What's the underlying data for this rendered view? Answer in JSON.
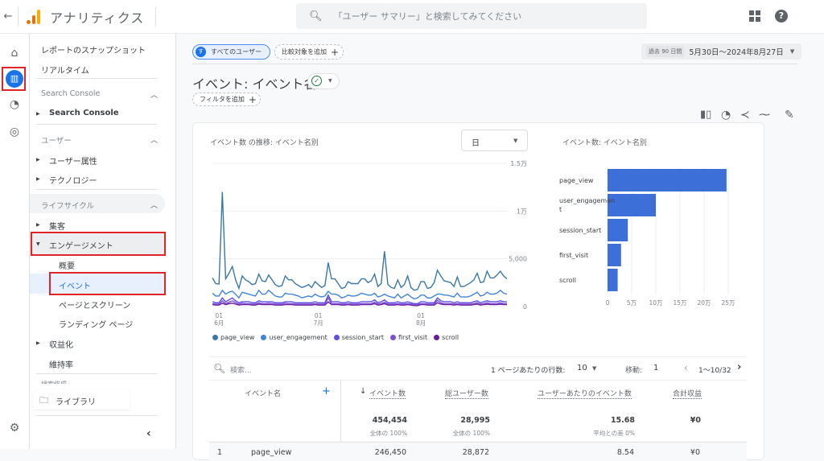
{
  "app": {
    "title": "アナリティクス",
    "back_icon": "arrow-left-icon",
    "logo_colors": [
      "#f9ab00",
      "#e37400",
      "#e37400"
    ]
  },
  "search": {
    "placeholder": "「ユーザー サマリー」と検索してみてください"
  },
  "header_icons": [
    "apps-grid-icon",
    "help-icon"
  ],
  "rail": [
    {
      "name": "home-icon",
      "glyph": "⌂"
    },
    {
      "name": "reports-icon",
      "glyph": "▥",
      "active": true
    },
    {
      "name": "explore-icon",
      "glyph": "◔"
    },
    {
      "name": "advertising-icon",
      "glyph": "◎"
    },
    {
      "name": "settings-icon",
      "glyph": "⚙"
    }
  ],
  "nav": {
    "top_items": [
      "レポートのスナップショット",
      "リアルタイム"
    ],
    "sections": [
      {
        "header": "Search Console",
        "items": [
          {
            "label": "Search Console",
            "bold": true
          }
        ]
      },
      {
        "header": "ユーザー",
        "items": [
          {
            "label": "ユーザー属性"
          },
          {
            "label": "テクノロジー"
          }
        ]
      },
      {
        "header": "ライフサイクル",
        "items": [
          {
            "label": "集客"
          },
          {
            "label": "エンゲージメント",
            "expanded": true
          }
        ]
      }
    ],
    "engagement_sub": [
      "概要",
      "イベント",
      "ページとスクリーン",
      "ランディング ページ"
    ],
    "after_items": [
      "収益化",
      "維持率"
    ],
    "partial_header": "検索作成",
    "library": "ライブラリ",
    "collapse_icon": "‹"
  },
  "main": {
    "segment_label": "すべてのユーザー",
    "segment_badge": "す",
    "compare_label": "比較対象を追加",
    "date_prefix": "過去 90 日間",
    "date_range": "5月30日～2024年8月27日",
    "page_title": "イベント: イベント名",
    "filter_label": "フィルタを追加",
    "toolbar_icons": [
      "compare-icon",
      "insights-icon",
      "share-icon",
      "trend-icon",
      "edit-icon"
    ]
  },
  "chart_data": [
    {
      "type": "line",
      "title": "イベント数 の推移: イベント名別",
      "granularity": "日",
      "y_ticks": [
        "0",
        "5,000",
        "1万",
        "1.5万"
      ],
      "ylim": [
        0,
        15000
      ],
      "x_ticks": [
        {
          "day": "01",
          "month": "6月"
        },
        {
          "day": "01",
          "month": "7月"
        },
        {
          "day": "01",
          "month": "8月"
        }
      ],
      "series": [
        {
          "name": "page_view",
          "color": "#3b78a6",
          "values": [
            3000,
            2400,
            2350,
            12000,
            2900,
            3500,
            4200,
            2800,
            1900,
            3200,
            2800,
            2600,
            2300,
            2400,
            3400,
            2700,
            2600,
            3300,
            2800,
            2300,
            2100,
            2200,
            3200,
            2800,
            2800,
            2400,
            2200,
            2000,
            2100,
            2300,
            2000,
            2600,
            2300,
            2000,
            2200,
            4600,
            2900,
            2900,
            2400,
            1900,
            2000,
            2600,
            2400,
            2400,
            2400,
            2900,
            2900,
            2500,
            2700,
            3400,
            2100,
            2400,
            5800,
            2300,
            2000,
            1900,
            2800,
            2000,
            2300,
            3200,
            2000,
            1700,
            1800,
            2600,
            2600,
            1900,
            2000,
            2500,
            3800,
            3200,
            2700,
            2600,
            2500,
            2100,
            3100,
            2100,
            2100,
            2300,
            2500,
            2800,
            3500,
            2500,
            2600,
            3700,
            3000,
            3000,
            3300,
            3700,
            3200,
            2900
          ]
        },
        {
          "name": "user_engagement",
          "color": "#4285d6",
          "values": [
            1400,
            1100,
            1100,
            1700,
            1300,
            1500,
            1600,
            1300,
            900,
            1500,
            1400,
            1300,
            1200,
            1100,
            1700,
            1300,
            1300,
            1700,
            1400,
            1100,
            1000,
            1000,
            1400,
            1300,
            1300,
            1200,
            1100,
            900,
            1000,
            1100,
            1000,
            1300,
            1100,
            1000,
            1100,
            1600,
            1300,
            1300,
            1200,
            900,
            1000,
            1200,
            1100,
            1100,
            1200,
            1400,
            1300,
            1200,
            1200,
            1400,
            1000,
            1100,
            1300,
            1100,
            1000,
            900,
            1300,
            900,
            1100,
            1300,
            1000,
            800,
            900,
            1200,
            1200,
            900,
            900,
            1100,
            1300,
            1300,
            1200,
            1200,
            1100,
            1000,
            1400,
            1000,
            1000,
            1000,
            1100,
            1300,
            1500,
            1100,
            1200,
            1500,
            1300,
            1300,
            1400,
            1700,
            1400,
            1300
          ]
        },
        {
          "name": "session_start",
          "color": "#5b4ee8",
          "values": [
            500,
            400,
            400,
            900,
            500,
            700,
            900,
            600,
            400,
            500,
            500,
            500,
            400,
            400,
            600,
            500,
            500,
            500,
            500,
            400,
            400,
            400,
            500,
            500,
            500,
            400,
            400,
            400,
            400,
            400,
            400,
            500,
            400,
            400,
            400,
            1200,
            500,
            500,
            500,
            400,
            400,
            500,
            400,
            400,
            400,
            500,
            500,
            500,
            500,
            700,
            400,
            500,
            700,
            400,
            400,
            400,
            500,
            400,
            400,
            500,
            400,
            300,
            300,
            500,
            500,
            400,
            400,
            400,
            900,
            600,
            500,
            500,
            500,
            400,
            500,
            400,
            400,
            400,
            400,
            500,
            600,
            400,
            500,
            600,
            500,
            500,
            500,
            600,
            500,
            500
          ]
        },
        {
          "name": "first_visit",
          "color": "#7e4fd6",
          "values": [
            300,
            250,
            250,
            600,
            300,
            450,
            600,
            400,
            250,
            350,
            300,
            300,
            250,
            250,
            400,
            300,
            300,
            350,
            300,
            250,
            250,
            250,
            350,
            300,
            300,
            250,
            250,
            250,
            250,
            250,
            250,
            300,
            250,
            250,
            250,
            900,
            300,
            300,
            300,
            250,
            250,
            300,
            250,
            250,
            250,
            300,
            300,
            300,
            300,
            450,
            250,
            300,
            450,
            250,
            250,
            250,
            300,
            250,
            250,
            300,
            250,
            200,
            200,
            300,
            300,
            250,
            250,
            250,
            650,
            400,
            300,
            300,
            300,
            250,
            300,
            250,
            250,
            250,
            250,
            300,
            400,
            250,
            300,
            400,
            300,
            300,
            300,
            400,
            300,
            300
          ]
        },
        {
          "name": "scroll",
          "color": "#6a1b9a",
          "values": [
            200,
            150,
            150,
            350,
            200,
            300,
            350,
            250,
            150,
            200,
            200,
            200,
            150,
            150,
            250,
            200,
            200,
            200,
            200,
            150,
            150,
            150,
            200,
            200,
            200,
            150,
            150,
            150,
            150,
            150,
            150,
            200,
            150,
            150,
            150,
            500,
            200,
            200,
            200,
            150,
            150,
            200,
            150,
            150,
            150,
            200,
            200,
            200,
            200,
            300,
            150,
            200,
            300,
            150,
            150,
            150,
            200,
            150,
            150,
            200,
            150,
            100,
            100,
            200,
            200,
            150,
            150,
            150,
            400,
            250,
            200,
            200,
            200,
            150,
            200,
            150,
            150,
            150,
            150,
            200,
            250,
            150,
            200,
            250,
            200,
            200,
            200,
            250,
            200,
            200
          ]
        }
      ]
    },
    {
      "type": "bar",
      "orientation": "horizontal",
      "title": "イベント数: イベント名別",
      "categories": [
        "page_view",
        "user_engagement",
        "session_start",
        "first_visit",
        "scroll"
      ],
      "values": [
        246450,
        100000,
        42000,
        28000,
        21000
      ],
      "x_ticks": [
        "0",
        "5万",
        "10万",
        "15万",
        "20万",
        "25万"
      ],
      "xlim": [
        0,
        250000
      ],
      "color": "#3c6fd8",
      "grid": true
    }
  ],
  "table": {
    "search_placeholder": "検索...",
    "rows_per_page_label": "1 ページあたりの行数:",
    "rows_per_page": "10",
    "goto_label": "移動:",
    "goto_value": "1",
    "page_range": "1～10/32",
    "columns": [
      "イベント名",
      "イベント数",
      "総ユーザー数",
      "ユーザーあたりのイベント数",
      "合計収益"
    ],
    "sort_icon": "↓",
    "totals": {
      "event_count": "454,454",
      "event_count_sub": "全体の 100%",
      "total_users": "28,995",
      "total_users_sub": "全体の 100%",
      "per_user": "15.68",
      "per_user_sub": "平均との差 0%",
      "revenue": "¥0"
    },
    "first_row": {
      "index": "1",
      "name": "page_view",
      "event_count": "246,450",
      "total_users": "28,872",
      "per_user": "8.54",
      "revenue": "¥0"
    }
  }
}
